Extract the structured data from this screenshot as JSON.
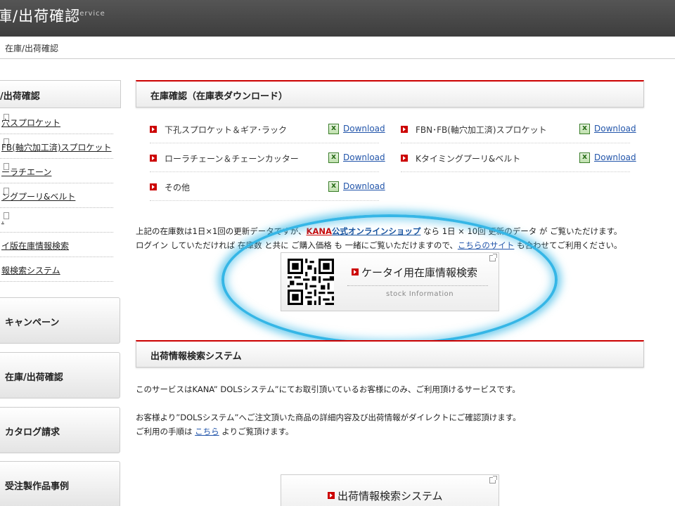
{
  "header": {
    "title": "庫/出荷確認",
    "subtitle": "service"
  },
  "breadcrumb": "在庫/出荷確認",
  "sidebar": {
    "heading": "/出荷確認",
    "items": [
      {
        "label": "穴スプロケット"
      },
      {
        "label": "FB(軸穴加工済)スプロケット"
      },
      {
        "label": "ーラチエーン"
      },
      {
        "label": "ングプーリ&ベルト"
      },
      {
        "label": "."
      },
      {
        "label": "イ版在庫情報検索"
      },
      {
        "label": "報検索システム"
      }
    ],
    "buttons": [
      {
        "label": "キャンペーン"
      },
      {
        "label": "在庫/出荷確認"
      },
      {
        "label": "カタログ請求"
      },
      {
        "label": "受注製作品事例"
      }
    ]
  },
  "stock": {
    "heading": "在庫確認（在庫表ダウンロード）",
    "download_label": "Download",
    "left_items": [
      "下孔スプロケット＆ギア･ラック",
      "ローラチェーン＆チェーンカッター",
      "その他"
    ],
    "right_items": [
      "FBN･FB(軸穴加工済)スプロケット",
      "Kタイミングプーリ&ベルト"
    ]
  },
  "notice": {
    "line1_pre": "上記の在庫数は1日×1回の更新データですが、",
    "line1_link_brand": "KANA",
    "line1_link": "公式オンラインショップ",
    "line1_post": " なら 1日 × 10回 更新のデータ が ご覧いただけます。",
    "line2_pre": "ログイン していただければ 在庫数 と共に ご購入価格 も 一緒にご覧いただけますので、",
    "line2_link": "こちらのサイト",
    "line2_post": " も合わせてご利用ください。"
  },
  "mobile_card": {
    "title": "ケータイ用在庫情報検索",
    "subtitle": "stock Information"
  },
  "shipping": {
    "heading": "出荷情報検索システム",
    "p1": "このサービスはKANA” DOLSシステム”にてお取引頂いているお客様にのみ、ご利用頂けるサービスです。",
    "p2": "お客様より”DOLSシステム”へご注文頂いた商品の詳細内容及び出荷情報がダイレクトにご確認頂けます。",
    "p3_pre": "ご利用の手順は ",
    "p3_link": "こちら",
    "p3_post": " よりご覧頂けます。",
    "card_title": "出荷情報検索システム"
  },
  "colors": {
    "accent": "#cc0000",
    "link": "#2255aa",
    "highlight": "#35b6e6",
    "topbar": "#444444"
  }
}
